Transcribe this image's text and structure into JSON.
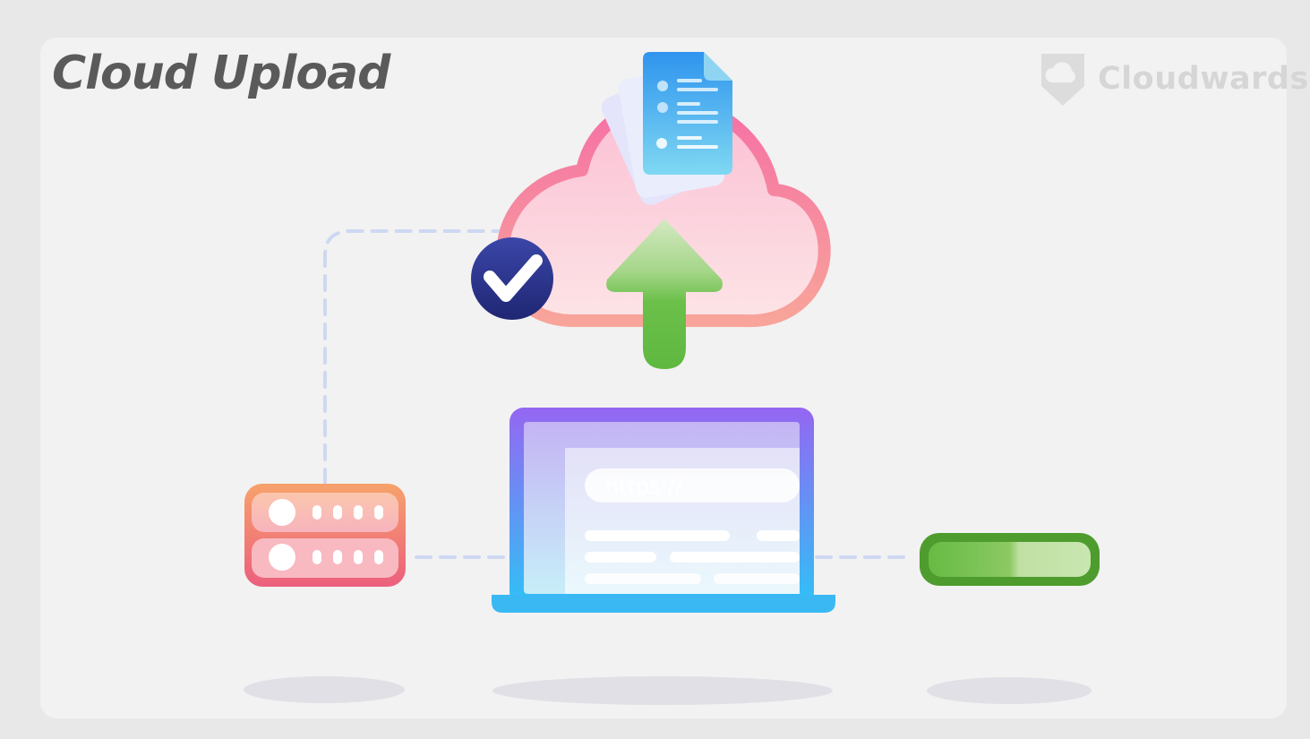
{
  "header": {
    "title": "Cloud Upload"
  },
  "brand": {
    "name": "Cloudwards",
    "icon": "cloud-shield-icon"
  },
  "browser": {
    "address_text": "https://"
  },
  "progress": {
    "fraction": 0.55,
    "color": "#66bb44"
  },
  "icons": {
    "check": "check-badge-icon",
    "upload": "upload-arrow-icon",
    "server": "server-icon",
    "documents": "documents-icon"
  },
  "colors": {
    "cloud_border": "#f6869f",
    "check_badge": "#2b3590",
    "arrow": "#6bc04a",
    "server_top": "#f7a26b",
    "server_bottom": "#ec5f7d",
    "laptop_top": "#9566f2",
    "laptop_bottom": "#2fc2f6",
    "progress_border": "#4f9c2e"
  }
}
